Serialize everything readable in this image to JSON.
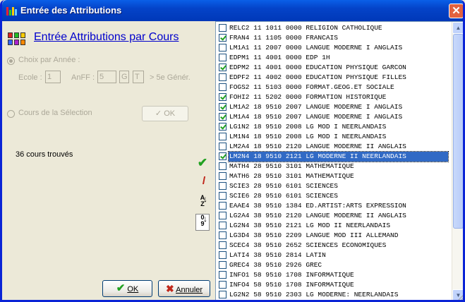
{
  "window": {
    "title": "Entrée des Attributions",
    "close_glyph": "✕"
  },
  "heading": {
    "title": "Entrée Attributions par Cours",
    "icon": "grid-colors-icon"
  },
  "choix": {
    "option_annee": "Choix par Année :",
    "ecole_label": "Ecole :",
    "ecole_value": "1",
    "anff_label": "AnFF :",
    "anff_value": "5",
    "g_value": "G",
    "t_value": "T",
    "suffix": "> 5e Génér.",
    "option_selection": "Cours de la Sélection",
    "ok_label": "OK"
  },
  "result": {
    "count_text": "36 cours trouvés"
  },
  "side_tools": [
    "check-all-icon",
    "uncheck-all-icon",
    "sort-az-icon",
    "sort-09-icon"
  ],
  "sort_az": {
    "top": "A",
    "bottom": "Z"
  },
  "sort_09": {
    "top": "0",
    "bottom": "9"
  },
  "footer": {
    "ok_label": "OK",
    "cancel_label": "Annuler"
  },
  "colors": {
    "accent": "#316AC5",
    "title_blue": "#0000CC",
    "check_green": "#21A121",
    "cancel_red": "#C0281C"
  },
  "courses": [
    {
      "text": "RELC2 11 1011 0000 RELIGION CATHOLIQUE",
      "checked": false
    },
    {
      "text": "FRAN4 11 1105 0000 FRANCAIS",
      "checked": true
    },
    {
      "text": "LM1A1 11 2007 0000 LANGUE MODERNE I ANGLAIS",
      "checked": false
    },
    {
      "text": "EDPM1 11 4001 0000 EDP 1H",
      "checked": false
    },
    {
      "text": "EDPM2 11 4001 0000 EDUCATION PHYSIQUE GARCON",
      "checked": true
    },
    {
      "text": "EDPF2 11 4002 0000 EDUCATION PHYSIQUE FILLES",
      "checked": false
    },
    {
      "text": "FOGS2 11 5103 0000 FORMAT.GEOG.ET SOCIALE",
      "checked": false
    },
    {
      "text": "FOHI2 11 5202 0000 FORMATION HISTORIQUE",
      "checked": true
    },
    {
      "text": "LM1A2 18 9510 2007 LANGUE MODERNE I ANGLAIS",
      "checked": true
    },
    {
      "text": "LM1A4 18 9510 2007 LANGUE MODERNE I ANGLAIS",
      "checked": true
    },
    {
      "text": "LG1N2 18 9510 2008 LG MOD I NEERLANDAIS",
      "checked": true
    },
    {
      "text": "LM1N4 18 9510 2008 LG MOD I NEERLANDAIS",
      "checked": false
    },
    {
      "text": "LM2A4 18 9510 2120 LANGUE MODERNE II ANGLAIS",
      "checked": false
    },
    {
      "text": "LM2N4 18 9510 2121 LG MODERNE II NEERLANDAIS",
      "checked": true,
      "selected": true
    },
    {
      "text": "MATH4 28 9510 3101 MATHEMATIQUE",
      "checked": false
    },
    {
      "text": "MATH6 28 9510 3101 MATHEMATIQUE",
      "checked": false
    },
    {
      "text": "SCIE3 28 9510 6101 SCIENCES",
      "checked": false
    },
    {
      "text": "SCIE6 28 9510 6101 SCIENCES",
      "checked": false
    },
    {
      "text": "EAAE4 38 9510 1384 ED.ARTIST:ARTS EXPRESSION",
      "checked": false
    },
    {
      "text": "LG2A4 38 9510 2120 LANGUE MODERNE II ANGLAIS",
      "checked": false
    },
    {
      "text": "LG2N4 38 9510 2121 LG MOD II NEERLANDAIS",
      "checked": false
    },
    {
      "text": "LG3D4 38 9510 2209 LANGUE MOD III ALLEMAND",
      "checked": false
    },
    {
      "text": "SCEC4 38 9510 2652 SCIENCES ECONOMIQUES",
      "checked": false
    },
    {
      "text": "LATI4 38 9510 2814 LATIN",
      "checked": false
    },
    {
      "text": "GREC4 38 9510 2926 GREC",
      "checked": false
    },
    {
      "text": "INFO1 58 9510 1708 INFORMATIQUE",
      "checked": false
    },
    {
      "text": "INFO4 58 9510 1708 INFORMATIQUE",
      "checked": false
    },
    {
      "text": "LG2N2 58 9510 2303 LG MODERNE: NEERLANDAIS",
      "checked": false
    }
  ]
}
